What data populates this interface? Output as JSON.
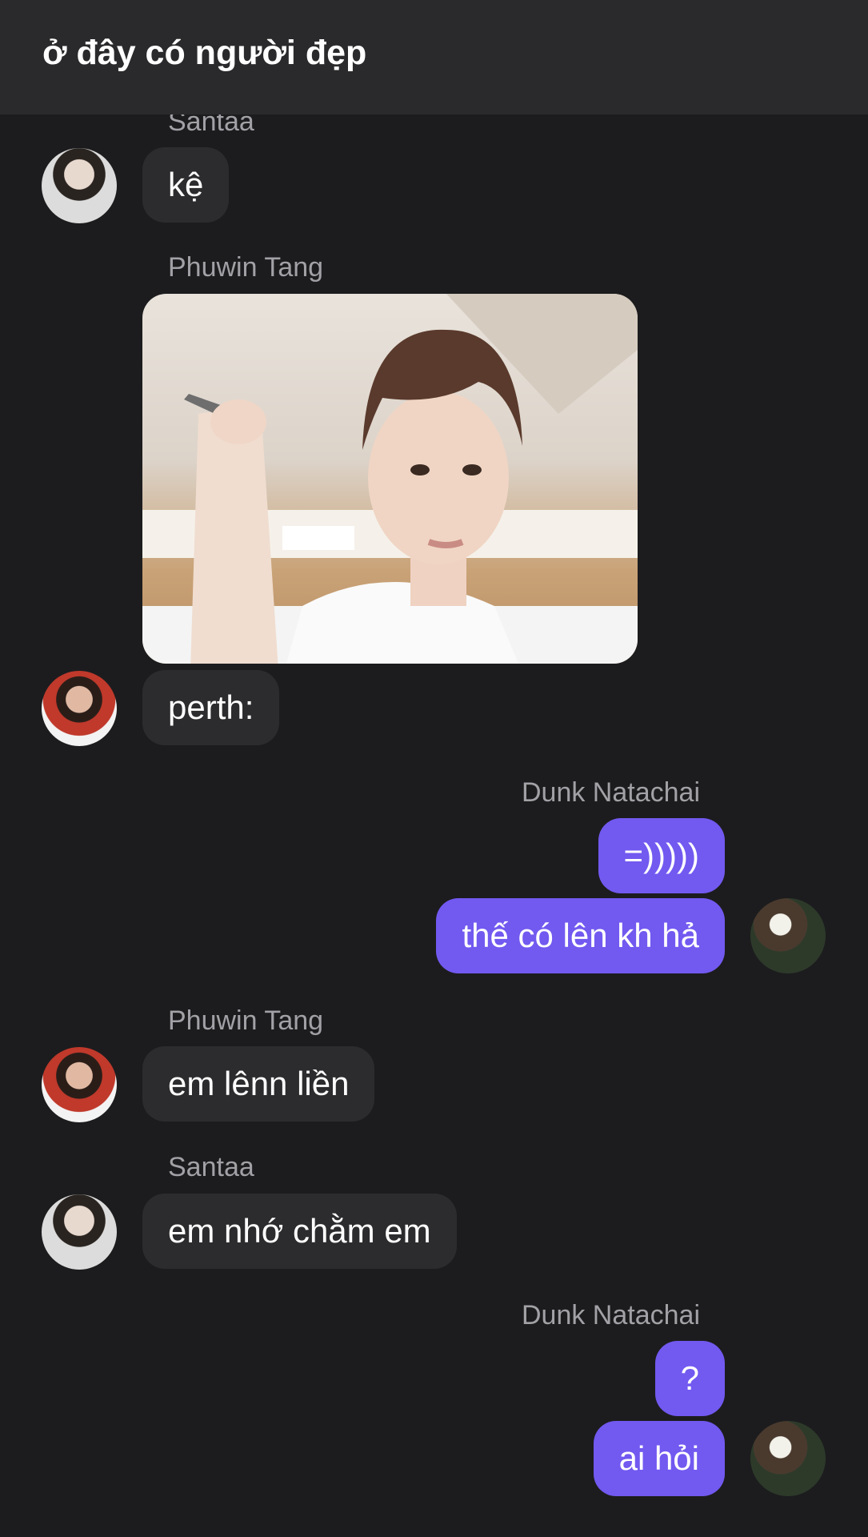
{
  "header": {
    "title": "ở đây có người đẹp"
  },
  "messages": [
    {
      "sender": "Santaa",
      "text": "kệ"
    },
    {
      "sender": "Phuwin Tang",
      "image": "photo-person-with-knife"
    },
    {
      "text": "perth:"
    },
    {
      "sender": "Dunk Natachai",
      "text": "=)))))"
    },
    {
      "text": "thế có lên kh hả"
    },
    {
      "sender": "Phuwin Tang",
      "text": "em lênn liền"
    },
    {
      "sender": "Santaa",
      "text": "em nhớ chằm em"
    },
    {
      "sender": "Dunk Natachai",
      "text": "?"
    },
    {
      "text": "ai hỏi"
    }
  ],
  "colors": {
    "background": "#1c1c1e",
    "header": "#2a2a2c",
    "incoming_bubble": "#2c2c2e",
    "outgoing_bubble": "#7259f0",
    "sender_name": "#a1a1a6"
  }
}
